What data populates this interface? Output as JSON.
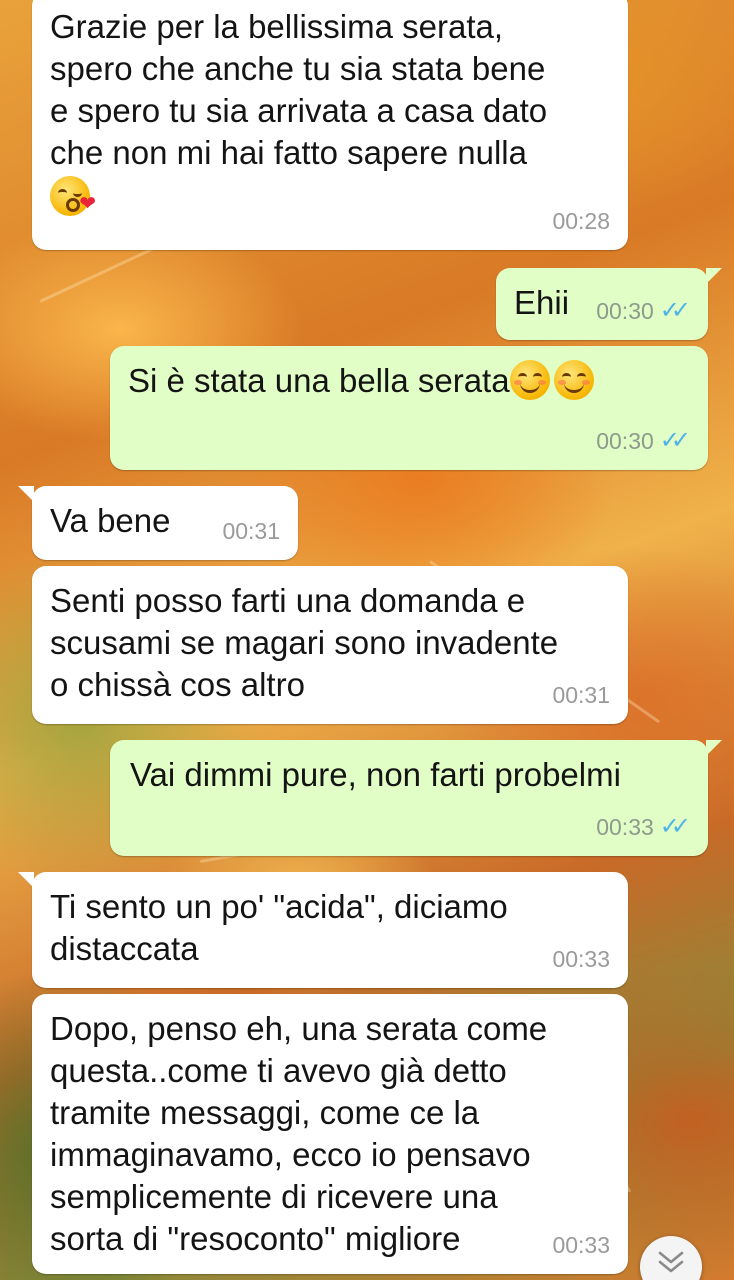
{
  "chat": {
    "messages": [
      {
        "dir": "in",
        "text": "Grazie per la bellissima serata,\nspero che anche tu sia stata bene\ne spero tu sia arrivata a casa dato\nche non mi hai fatto sapere nulla",
        "emoji": "kissing-face-with-heart",
        "time": "00:28"
      },
      {
        "dir": "out",
        "text": "Ehii",
        "time": "00:30",
        "status": "read"
      },
      {
        "dir": "out",
        "text": "Si è stata una bella serata",
        "emoji": "smiling-face x2",
        "time": "00:30",
        "status": "read"
      },
      {
        "dir": "in",
        "text": "Va bene",
        "time": "00:31"
      },
      {
        "dir": "in",
        "text": "Senti posso farti una domanda e\nscusami se magari sono invadente\no chissà cos altro",
        "time": "00:31"
      },
      {
        "dir": "out",
        "text": "Vai dimmi pure, non farti probelmi",
        "time": "00:33",
        "status": "read"
      },
      {
        "dir": "in",
        "text": "Ti sento un po' \"acida\", diciamo\ndistaccata",
        "time": "00:33"
      },
      {
        "dir": "in",
        "text": "Dopo, penso eh, una serata come\nquesta..come ti avevo già detto\ntramite messaggi, come ce la\nimmaginavamo, ecco io pensavo\nsemplicemente di ricevere una\nsorta di \"resoconto\" migliore",
        "time": "00:33"
      }
    ]
  },
  "colors": {
    "incoming_bubble": "#ffffff",
    "outgoing_bubble": "#e1fec6",
    "read_ticks": "#4fb3e8",
    "timestamp": "#9a9a9a"
  },
  "icons": {
    "read_receipt": "double-check-icon",
    "scroll": "chevron-double-down-icon"
  }
}
